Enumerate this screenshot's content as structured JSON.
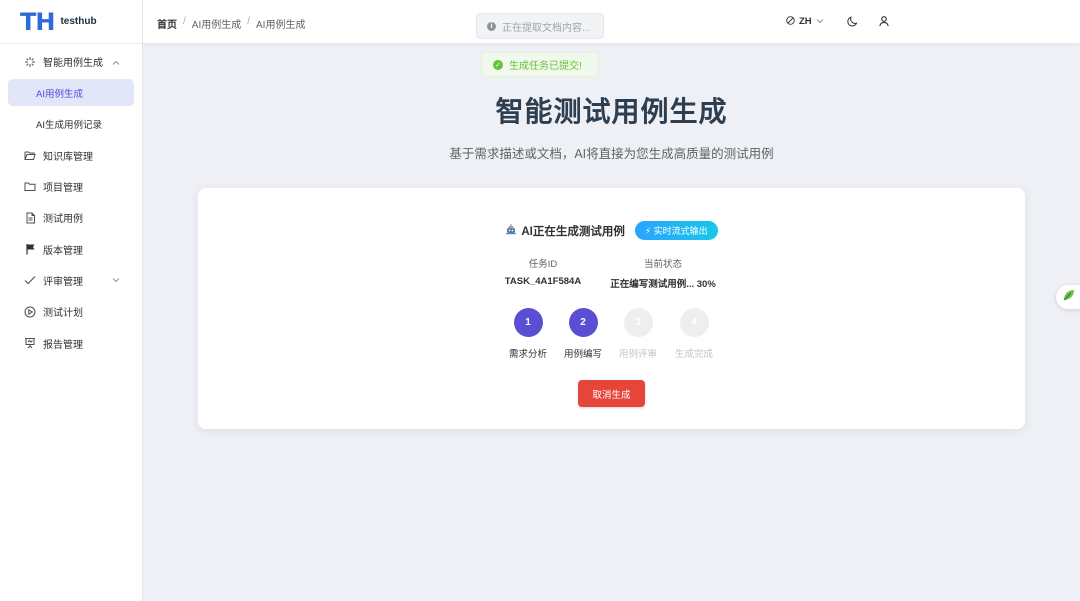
{
  "app": {
    "logo_mark": "TH",
    "logo_text": "testhub"
  },
  "sidebar": {
    "items": [
      {
        "label": "智能用例生成",
        "icon": "sparkle-icon",
        "expanded": true
      },
      {
        "label": "AI用例生成",
        "sub": true,
        "active": true
      },
      {
        "label": "AI生成用例记录",
        "sub": true
      },
      {
        "label": "知识库管理",
        "icon": "folder-open-icon"
      },
      {
        "label": "项目管理",
        "icon": "folder-icon"
      },
      {
        "label": "测试用例",
        "icon": "document-icon"
      },
      {
        "label": "版本管理",
        "icon": "flag-icon"
      },
      {
        "label": "评审管理",
        "icon": "check-icon",
        "expanded": false
      },
      {
        "label": "测试计划",
        "icon": "play-circle-icon"
      },
      {
        "label": "报告管理",
        "icon": "presentation-icon"
      }
    ]
  },
  "header": {
    "breadcrumb": [
      "首页",
      "AI用例生成",
      "AI用例生成"
    ],
    "extract_status": "正在提取文档内容...",
    "language": "ZH"
  },
  "toast": {
    "text": "生成任务已提交!"
  },
  "main": {
    "title": "智能测试用例生成",
    "subtitle": "基于需求描述或文档，AI将直接为您生成高质量的测试用例"
  },
  "card": {
    "title": "AI正在生成测试用例",
    "stream_badge": "⚡ 实时流式输出",
    "task_id_label": "任务ID",
    "task_id": "TASK_4A1F584A",
    "status_label": "当前状态",
    "status_value": "正在编写测试用例... 30%",
    "progress_percent": 30,
    "steps": [
      {
        "num": "1",
        "label": "需求分析",
        "state": "done"
      },
      {
        "num": "2",
        "label": "用例编写",
        "state": "done"
      },
      {
        "num": "3",
        "label": "用例评审",
        "state": "todo"
      },
      {
        "num": "4",
        "label": "生成完成",
        "state": "todo"
      }
    ],
    "cancel_label": "取消生成"
  },
  "colors": {
    "primary": "#5a4fd3",
    "danger": "#e6453a",
    "success": "#67c23a",
    "badge": "#2aa4ff"
  }
}
